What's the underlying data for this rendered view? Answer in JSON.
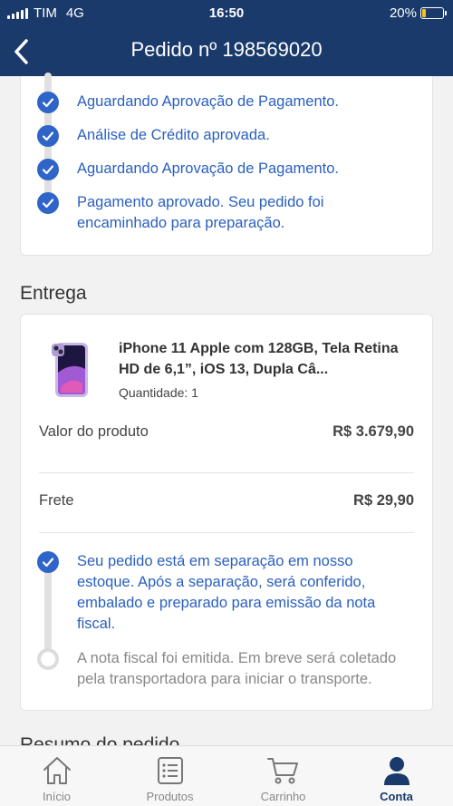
{
  "status_bar": {
    "carrier": "TIM",
    "network": "4G",
    "time": "16:50",
    "battery": "20%",
    "battery_level": 0.2
  },
  "header": {
    "title": "Pedido nº 198569020",
    "back_icon": "chevron-left-icon"
  },
  "status_history": [
    "Aguardando Aprovação de Pagamento.",
    "Análise de Crédito aprovada.",
    "Aguardando Aprovação de Pagamento.",
    "Pagamento aprovado. Seu pedido foi encaminhado para preparação."
  ],
  "entrega": {
    "section_title": "Entrega",
    "product": {
      "name": "iPhone 11 Apple com 128GB, Tela Retina HD de 6,1”, iOS 13, Dupla Câ...",
      "quantity": "Quantidade: 1"
    },
    "valor_label": "Valor do produto",
    "valor_value": "R$  3.679,90",
    "frete_label": "Frete",
    "frete_value": "R$  29,90",
    "tracking": [
      {
        "text": "Seu pedido está em separação em nosso estoque. Após a separação, será conferido, embalado e preparado para emissão da nota fiscal.",
        "done": true
      },
      {
        "text": "A nota fiscal foi emitida. Em breve será coletado pela transportadora para iniciar o transporte.",
        "done": false
      }
    ]
  },
  "next_section_peek": "Resumo do pedido",
  "tabbar": [
    {
      "label": "Início",
      "icon": "home-icon",
      "active": false
    },
    {
      "label": "Produtos",
      "icon": "list-icon",
      "active": false
    },
    {
      "label": "Carrinho",
      "icon": "cart-icon",
      "active": false
    },
    {
      "label": "Conta",
      "icon": "user-icon",
      "active": true
    }
  ],
  "colors": {
    "brand": "#1a3a6b",
    "accent": "#2f64c9"
  }
}
